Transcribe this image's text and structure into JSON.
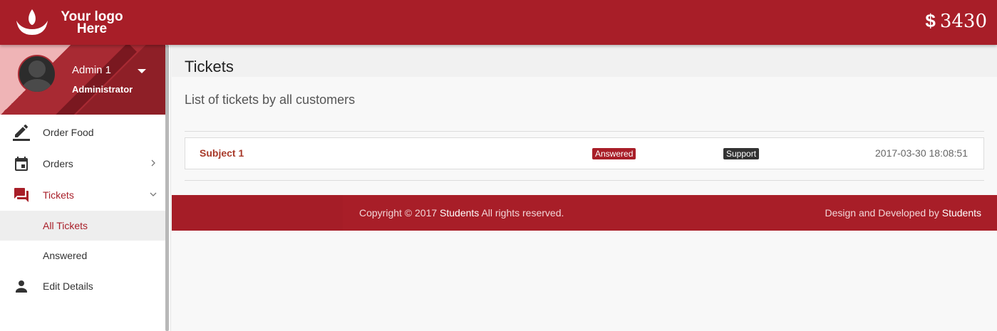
{
  "header": {
    "logo_line1": "Your logo",
    "logo_line2": "Here",
    "balance_currency": "$",
    "balance_amount": "3430",
    "brand_color": "#a81e28"
  },
  "user": {
    "name": "Admin 1",
    "role": "Administrator"
  },
  "sidebar": {
    "items": [
      {
        "label": "Order Food",
        "icon": "edit-icon"
      },
      {
        "label": "Orders",
        "icon": "calendar-icon"
      },
      {
        "label": "Tickets",
        "icon": "forum-icon"
      },
      {
        "label": "All Tickets"
      },
      {
        "label": "Answered"
      },
      {
        "label": "Edit Details",
        "icon": "person-icon"
      }
    ]
  },
  "main": {
    "title": "Tickets",
    "subtitle": "List of tickets by all customers",
    "tickets": [
      {
        "subject": "Subject 1",
        "status": "Answered",
        "type": "Support",
        "date": "2017-03-30 18:08:51"
      }
    ]
  },
  "footer": {
    "copy_prefix": "Copyright © 2017",
    "copy_brand": "Students",
    "copy_suffix": "All rights reserved.",
    "credit_prefix": "Design and Developed by",
    "credit_brand": "Students"
  }
}
